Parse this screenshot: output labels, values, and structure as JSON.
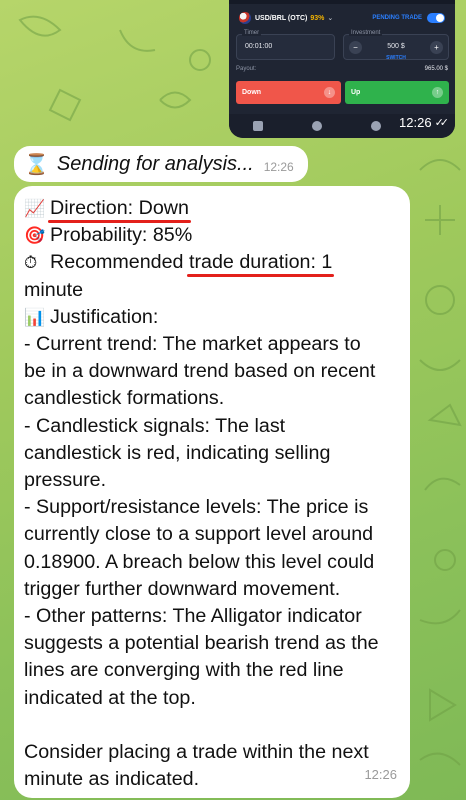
{
  "trade_screenshot": {
    "pair": "USD/BRL (OTC)",
    "payout_percent": "93%",
    "pending_trade_label": "PENDING TRADE",
    "timer_label": "Timer",
    "timer_value": "00:01:00",
    "investment_label": "Investment",
    "investment_value": "500 $",
    "switch_label": "SWITCH",
    "payout_label": "Payout:",
    "payout_value": "965.00 $",
    "down_label": "Down",
    "up_label": "Up",
    "sent_time": "12:26"
  },
  "messages": {
    "sending": {
      "text": "Sending for analysis...",
      "time": "12:26",
      "icon": "hourglass-icon"
    },
    "analysis": {
      "direction": "Direction: Down",
      "probability": "Probability: 85%",
      "duration_prefix": "Recommended ",
      "duration_underlined": "trade duration: 1",
      "duration_suffix": "minute",
      "justification_title": "Justification:",
      "lines": [
        "- Current trend: The market appears to",
        "be in a downward trend based on recent",
        "candlestick formations.",
        "- Candlestick signals: The last",
        "candlestick is red, indicating selling",
        "pressure.",
        "- Support/resistance levels: The price is",
        "currently close to a support level around",
        "0.18900. A breach below this level could",
        "trigger further downward movement.",
        "- Other patterns: The Alligator indicator",
        "suggests a potential bearish trend as the",
        "lines are converging with the red line",
        "indicated at the top."
      ],
      "closing": [
        "Consider placing a trade within the next",
        "minute as indicated."
      ],
      "time": "12:26",
      "icons": [
        "chart-down-icon",
        "target-icon",
        "stopwatch-icon",
        "bar-chart-icon"
      ]
    }
  },
  "colors": {
    "wallpaper": "#9fc95c",
    "underline": "#e3201b",
    "down_button": "#f0564a",
    "up_button": "#2fb24c"
  }
}
